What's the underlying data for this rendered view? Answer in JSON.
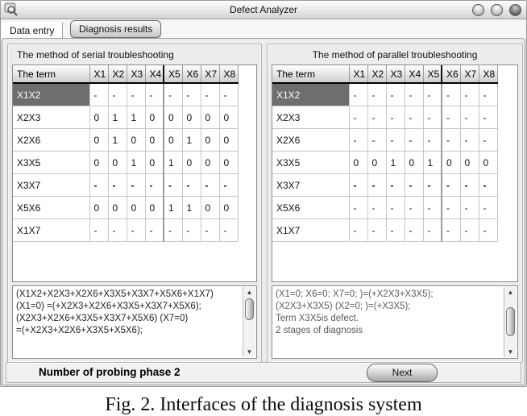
{
  "window": {
    "title": "Defect Analyzer"
  },
  "tabs": [
    {
      "label": "Data entry",
      "active": false
    },
    {
      "label": "Diagnosis results",
      "active": true
    }
  ],
  "panels": [
    {
      "title": "The method of serial troubleshooting",
      "table": {
        "term_header": "The term",
        "columns": [
          "X1",
          "X2",
          "X3",
          "X4",
          "X5",
          "X6",
          "X7",
          "X8"
        ],
        "divider_before_index": 4,
        "rows": [
          {
            "term": "X1X2",
            "values": [
              "-",
              "-",
              "-",
              "-",
              "-",
              "-",
              "-",
              "-"
            ],
            "selected": true
          },
          {
            "term": "X2X3",
            "values": [
              "0",
              "1",
              "1",
              "0",
              "0",
              "0",
              "0",
              "0"
            ]
          },
          {
            "term": "X2X6",
            "values": [
              "0",
              "1",
              "0",
              "0",
              "0",
              "1",
              "0",
              "0"
            ]
          },
          {
            "term": "X3X5",
            "values": [
              "0",
              "0",
              "1",
              "0",
              "1",
              "0",
              "0",
              "0"
            ]
          },
          {
            "term": "X3X7",
            "values": [
              "-",
              "-",
              "-",
              "-",
              "-",
              "-",
              "-",
              "-"
            ],
            "bold": true
          },
          {
            "term": "X5X6",
            "values": [
              "0",
              "0",
              "0",
              "0",
              "1",
              "1",
              "0",
              "0"
            ]
          },
          {
            "term": "X1X7",
            "values": [
              "-",
              "-",
              "-",
              "-",
              "-",
              "-",
              "-",
              "-"
            ]
          }
        ]
      },
      "log_lines": [
        "(X1X2+X2X3+X2X6+X3X5+X3X7+X5X6+X1X7)",
        "(X1=0) =(+X2X3+X2X6+X3X5+X3X7+X5X6);",
        "(X2X3+X2X6+X3X5+X3X7+X5X6) (X7=0)",
        "=(+X2X3+X2X6+X3X5+X5X6);"
      ]
    },
    {
      "title": "The method of parallel troubleshooting",
      "table": {
        "term_header": "The term",
        "columns": [
          "X1",
          "X2",
          "X3",
          "X4",
          "X5",
          "X6",
          "X7",
          "X8"
        ],
        "divider_before_index": 5,
        "rows": [
          {
            "term": "X1X2",
            "values": [
              "-",
              "-",
              "-",
              "-",
              "-",
              "-",
              "-",
              "-"
            ],
            "selected": true
          },
          {
            "term": "X2X3",
            "values": [
              "-",
              "-",
              "-",
              "-",
              "-",
              "-",
              "-",
              "-"
            ]
          },
          {
            "term": "X2X6",
            "values": [
              "-",
              "-",
              "-",
              "-",
              "-",
              "-",
              "-",
              "-"
            ]
          },
          {
            "term": "X3X5",
            "values": [
              "0",
              "0",
              "1",
              "0",
              "1",
              "0",
              "0",
              "0"
            ]
          },
          {
            "term": "X3X7",
            "values": [
              "-",
              "-",
              "-",
              "-",
              "-",
              "-",
              "-",
              "-"
            ],
            "bold": true
          },
          {
            "term": "X5X6",
            "values": [
              "-",
              "-",
              "-",
              "-",
              "-",
              "-",
              "-",
              "-"
            ]
          },
          {
            "term": "X1X7",
            "values": [
              "-",
              "-",
              "-",
              "-",
              "-",
              "-",
              "-",
              "-"
            ]
          }
        ]
      },
      "log_lines": [
        "(X1=0; X6=0; X7=0; )=(+X2X3+X3X5);",
        "(X2X3+X3X5) (X2=0; )=(+X3X5);",
        "Term X3X5is defect.",
        "2 stages of diagnosis"
      ]
    }
  ],
  "footer": {
    "status_label": "Number of probing phase 2",
    "next_label": "Next"
  },
  "caption": "Fig. 2. Interfaces of the diagnosis system",
  "colors": {
    "selection_bg": "#6e6e6e",
    "selection_text": "#ffffff",
    "header_divider": "#000000"
  }
}
